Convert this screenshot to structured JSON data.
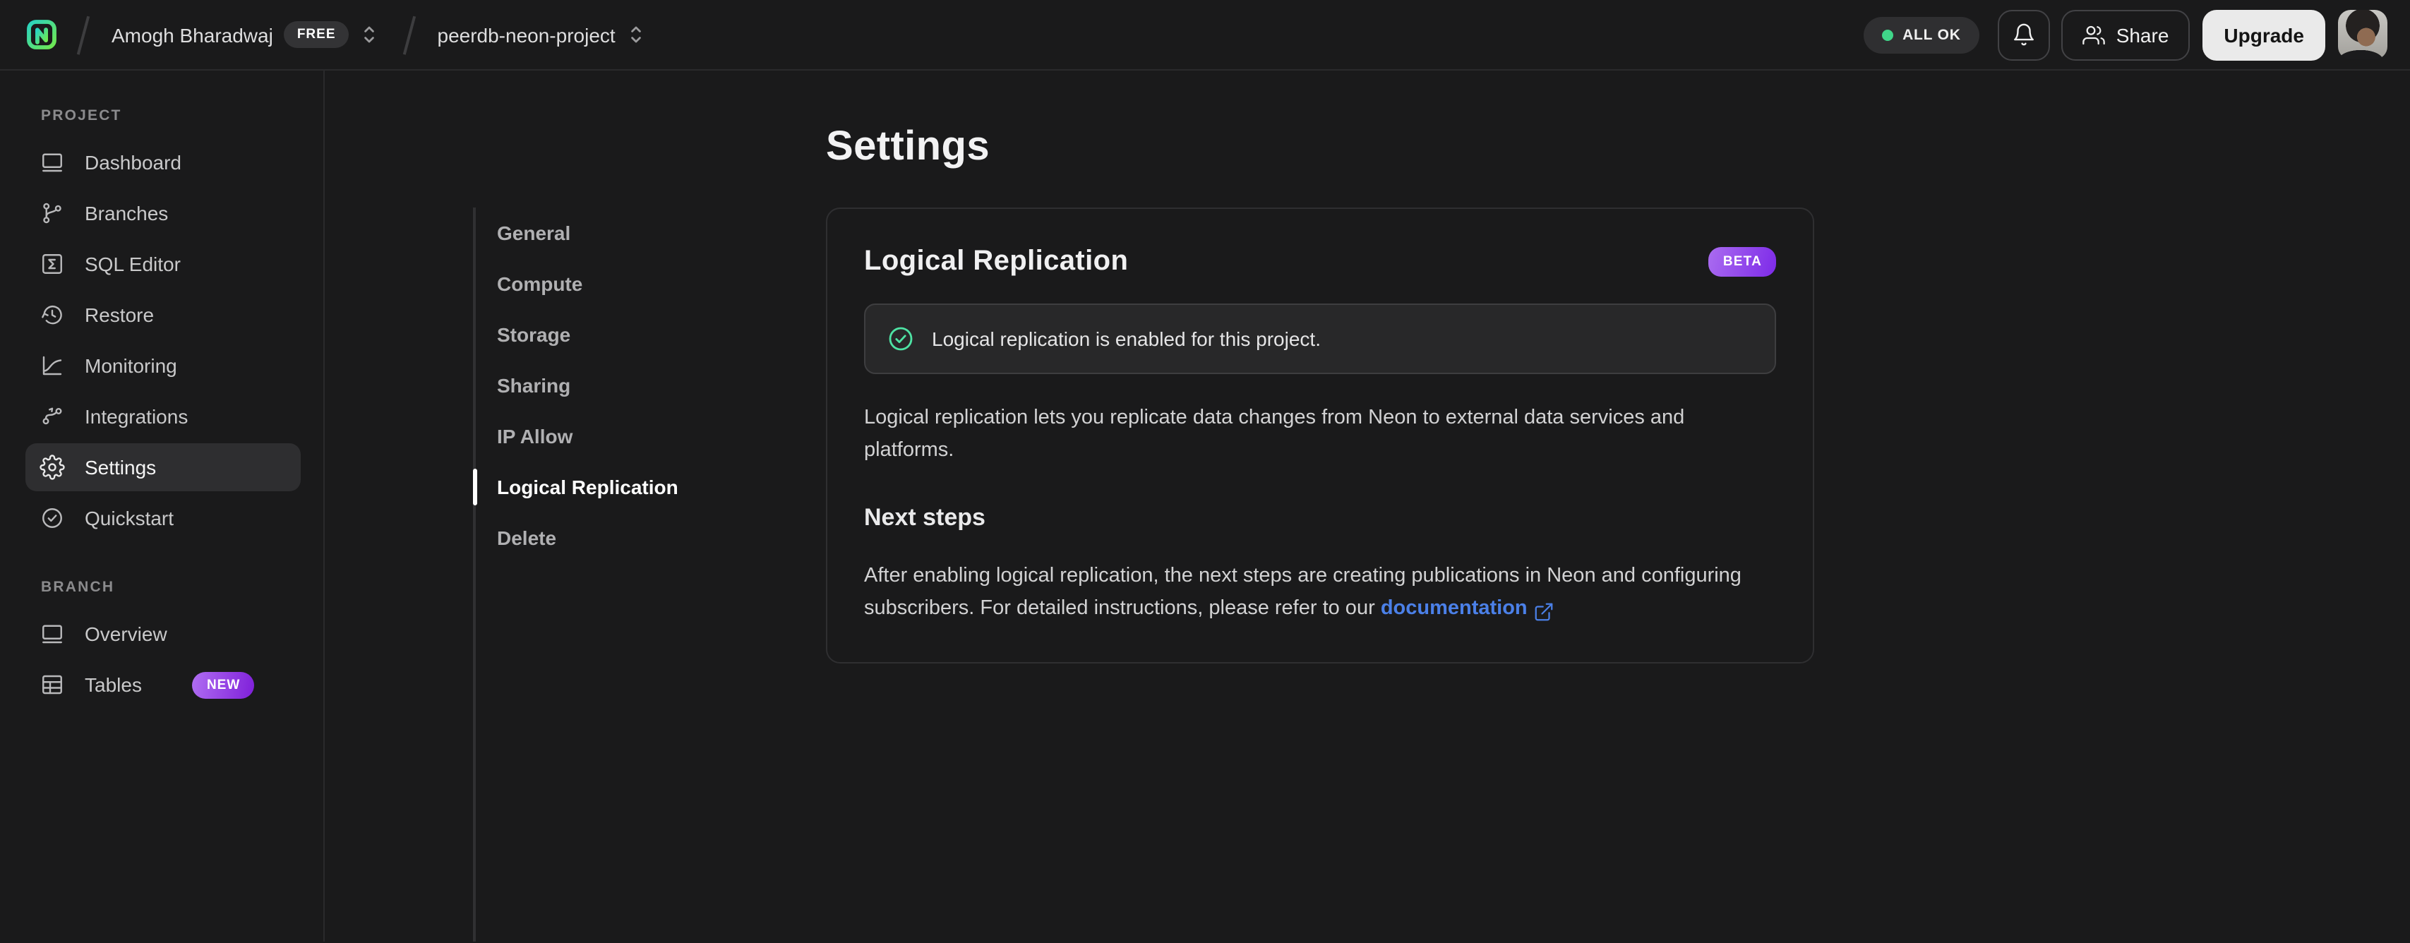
{
  "header": {
    "org": {
      "name": "Amogh Bharadwaj",
      "plan_badge": "FREE"
    },
    "project": {
      "name": "peerdb-neon-project"
    },
    "status_badge": "ALL OK",
    "share_label": "Share",
    "upgrade_label": "Upgrade"
  },
  "sidebar": {
    "sections": [
      {
        "label": "PROJECT",
        "items": [
          {
            "label": "Dashboard"
          },
          {
            "label": "Branches"
          },
          {
            "label": "SQL Editor"
          },
          {
            "label": "Restore"
          },
          {
            "label": "Monitoring"
          },
          {
            "label": "Integrations"
          },
          {
            "label": "Settings"
          },
          {
            "label": "Quickstart"
          }
        ]
      },
      {
        "label": "BRANCH",
        "items": [
          {
            "label": "Overview"
          },
          {
            "label": "Tables",
            "badge": "NEW"
          }
        ]
      }
    ]
  },
  "settings_nav": {
    "items": [
      {
        "label": "General"
      },
      {
        "label": "Compute"
      },
      {
        "label": "Storage"
      },
      {
        "label": "Sharing"
      },
      {
        "label": "IP Allow"
      },
      {
        "label": "Logical Replication"
      },
      {
        "label": "Delete"
      }
    ]
  },
  "main": {
    "title": "Settings",
    "card": {
      "title": "Logical Replication",
      "beta_badge": "BETA",
      "alert_text": "Logical replication is enabled for this project.",
      "description": "Logical replication lets you replicate data changes from Neon to external data services and platforms.",
      "next_steps_title": "Next steps",
      "next_steps_text": "After enabling logical replication, the next steps are creating publications in Neon and configuring subscribers. For detailed instructions, please refer to our ",
      "link_label": "documentation"
    }
  },
  "colors": {
    "background": "#1a1a1b",
    "border": "#2a2a2c",
    "success_green": "#4ee3a4",
    "status_dot_green": "#40d689",
    "link_blue": "#4b80e8",
    "badge_purple_start": "#aa6cf0",
    "badge_purple_end": "#7d2ae8",
    "logo_gradient_start": "#29d3c2",
    "logo_gradient_end": "#71e84e"
  }
}
